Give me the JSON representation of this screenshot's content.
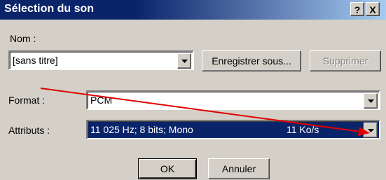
{
  "window": {
    "title": "Sélection du son",
    "help_glyph": "?",
    "close_glyph": "X"
  },
  "name_section": {
    "label": "Nom :",
    "value": "[sans titre]",
    "save_as_label": "Enregistrer sous...",
    "delete_label": "Supprimer"
  },
  "format": {
    "label": "Format :",
    "value": "PCM"
  },
  "attributes": {
    "label": "Attributs :",
    "value": "11 025 Hz; 8 bits; Mono",
    "rate": "11 Ko/s"
  },
  "buttons": {
    "ok_label": "OK",
    "cancel_label": "Annuler"
  },
  "colors": {
    "titlebar": "#0a246a",
    "selection": "#0a246a",
    "annotation_arrow": "#e00000"
  }
}
